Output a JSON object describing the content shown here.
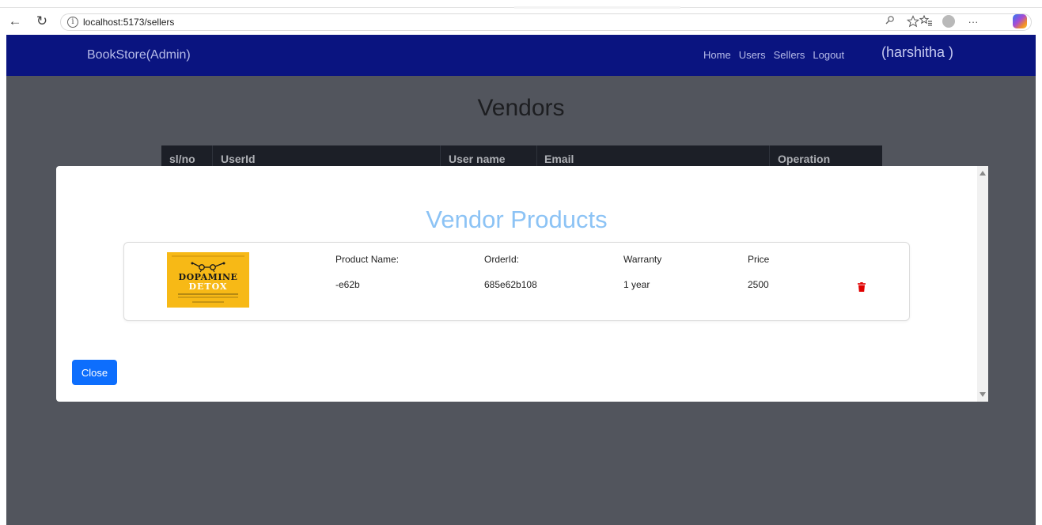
{
  "browser": {
    "url": "localhost:5173/sellers",
    "info_glyph": "i",
    "icons": [
      "back-icon",
      "refresh-icon",
      "site-info-icon",
      "read-aloud-icon",
      "favorite-icon",
      "favorites-bar-icon",
      "profile-avatar-icon",
      "more-icon",
      "copilot-icon"
    ],
    "back_glyph": "←",
    "refresh_glyph": "↻",
    "more_glyph": "···"
  },
  "navbar": {
    "brand": "BookStore(Admin)",
    "links": [
      "Home",
      "Users",
      "Sellers",
      "Logout"
    ],
    "user": "(harshitha )",
    "color": "#0a1480"
  },
  "page": {
    "title": "Vendors",
    "table_headers": [
      "sl/no",
      "UserId",
      "User name",
      "Email",
      "Operation"
    ]
  },
  "modal": {
    "title": "Vendor Products",
    "product": {
      "cover_title_1": "DOPAMINE",
      "cover_title_2": "DETOX",
      "labels": {
        "name": "Product Name:",
        "order": "OrderId:",
        "warranty": "Warranty",
        "price": "Price"
      },
      "values": {
        "name": "-e62b",
        "order": "685e62b108",
        "warranty": "1 year",
        "price": "2500"
      },
      "delete_icon": "trash-icon",
      "delete_color": "#e00000"
    },
    "close_label": "Close",
    "accent": "#0d6efd",
    "title_color": "#8cc3f5"
  }
}
